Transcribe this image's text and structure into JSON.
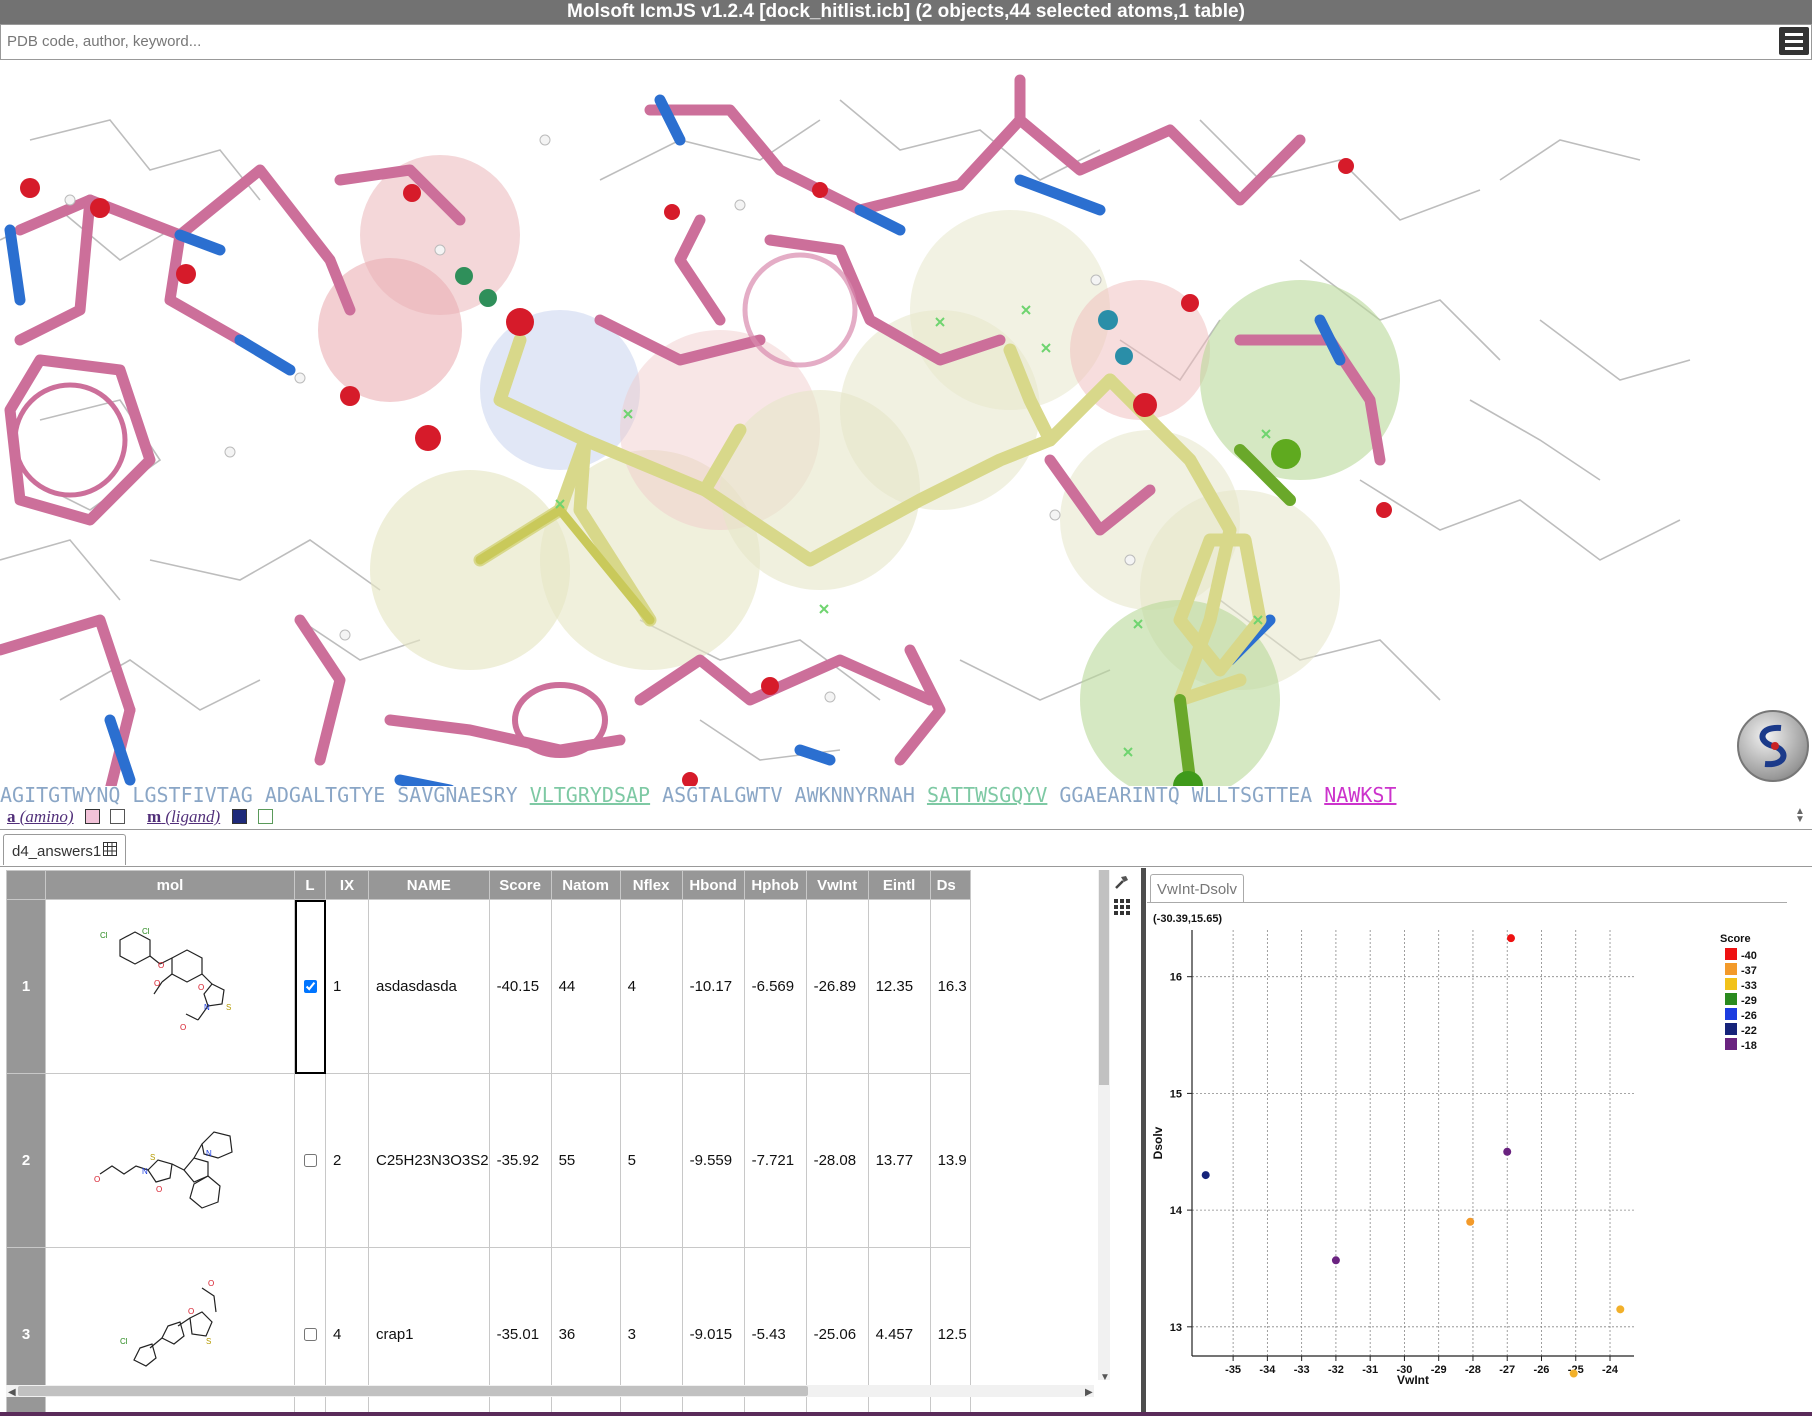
{
  "window": {
    "title": "Molsoft IcmJS v1.2.4 [dock_hitlist.icb] (2 objects,44 selected atoms,1 table)"
  },
  "search": {
    "placeholder": "PDB code, author, keyword..."
  },
  "sequence": {
    "segments": [
      {
        "text": "AGITGTWYNQ"
      },
      {
        "text": "LGSTFIVTAG"
      },
      {
        "text": "ADGALTGTYE"
      },
      {
        "text": "SAVGNAESRY"
      },
      {
        "text": "VLTGRYDSAP"
      },
      {
        "text": "ASGTALGWTV"
      },
      {
        "text": "AWKNNYRNAH"
      },
      {
        "text": "SATTWSGQYV"
      },
      {
        "text": "GGAEARINTQ"
      },
      {
        "text": "WLLTSGTTEA"
      },
      {
        "text": "NAWKST"
      }
    ]
  },
  "objects": [
    {
      "letter": "a",
      "name": "(amino)"
    },
    {
      "letter": "m",
      "name": "(ligand)"
    }
  ],
  "table_tab": {
    "label": "d4_answers1"
  },
  "table": {
    "columns": [
      "mol",
      "L",
      "IX",
      "NAME",
      "Score",
      "Natom",
      "Nflex",
      "Hbond",
      "Hphob",
      "VwInt",
      "Eintl",
      "Ds"
    ],
    "rows": [
      {
        "row": "1",
        "checked": true,
        "IX": "1",
        "NAME": "asdasdasda",
        "Score": "-40.15",
        "Natom": "44",
        "Nflex": "4",
        "Hbond": "-10.17",
        "Hphob": "-6.569",
        "VwInt": "-26.89",
        "Eintl": "12.35",
        "Ds": "16.3"
      },
      {
        "row": "2",
        "checked": false,
        "IX": "2",
        "NAME": "C25H23N3O3S2",
        "Score": "-35.92",
        "Natom": "55",
        "Nflex": "5",
        "Hbond": "-9.559",
        "Hphob": "-7.721",
        "VwInt": "-28.08",
        "Eintl": "13.77",
        "Ds": "13.9"
      },
      {
        "row": "3",
        "checked": false,
        "IX": "4",
        "NAME": "crap1",
        "Score": "-35.01",
        "Natom": "36",
        "Nflex": "3",
        "Hbond": "-9.015",
        "Hphob": "-5.43",
        "VwInt": "-25.06",
        "Eintl": "4.457",
        "Ds": "12.5"
      }
    ]
  },
  "plot_tab": {
    "label": "VwInt-Dsolv"
  },
  "chart_data": {
    "type": "scatter",
    "title": "",
    "cursor_readout": "(-30.39,15.65)",
    "xlabel": "VwInt",
    "ylabel": "Dsolv",
    "xlim": [
      -36.2,
      -23.3
    ],
    "ylim": [
      12.75,
      16.4
    ],
    "xticks": [
      -35,
      -34,
      -33,
      -32,
      -31,
      -30,
      -29,
      -28,
      -27,
      -26,
      -25,
      -24
    ],
    "yticks": [
      13,
      14,
      15,
      16
    ],
    "grid": true,
    "legend": {
      "title": "Score",
      "position": "right",
      "entries": [
        {
          "label": "-40",
          "color": "#ee1111"
        },
        {
          "label": "-37",
          "color": "#f39a2a"
        },
        {
          "label": "-33",
          "color": "#f2c21a"
        },
        {
          "label": "-29",
          "color": "#2a8a1f"
        },
        {
          "label": "-26",
          "color": "#1c3ce0"
        },
        {
          "label": "-22",
          "color": "#16237a"
        },
        {
          "label": "-18",
          "color": "#6a2380"
        }
      ]
    },
    "points": [
      {
        "x": -26.89,
        "y": 16.33,
        "score": -40.15,
        "color": "#ee1111"
      },
      {
        "x": -35.8,
        "y": 14.3,
        "score": -22,
        "color": "#16237a"
      },
      {
        "x": -27.0,
        "y": 14.5,
        "score": -19,
        "color": "#6a2380"
      },
      {
        "x": -28.08,
        "y": 13.9,
        "score": -35.92,
        "color": "#f39a2a"
      },
      {
        "x": -32.0,
        "y": 13.57,
        "score": -19,
        "color": "#6a2380"
      },
      {
        "x": -23.7,
        "y": 13.15,
        "score": -35.5,
        "color": "#f2b02a"
      },
      {
        "x": -25.06,
        "y": 12.6,
        "score": -35.01,
        "color": "#f2b02a"
      }
    ]
  }
}
